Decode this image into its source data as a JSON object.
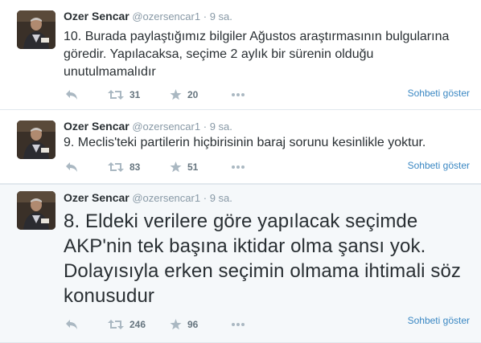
{
  "tweets": [
    {
      "name": "Ozer Sencar",
      "handle": "@ozersencar1",
      "dot": "·",
      "time": "9 sa.",
      "text": "10. Burada paylaştığımız bilgiler Ağustos araştırmasının bulgularına göredir. Yapılacaksa, seçime 2 aylık bir sürenin olduğu unutulmamalıdır",
      "retweets": "31",
      "favorites": "20",
      "conversation": "Sohbeti göster"
    },
    {
      "name": "Ozer Sencar",
      "handle": "@ozersencar1",
      "dot": "·",
      "time": "9 sa.",
      "text": "9. Meclis'teki partilerin hiçbirisinin baraj sorunu kesinlikle yoktur.",
      "retweets": "83",
      "favorites": "51",
      "conversation": "Sohbeti göster"
    },
    {
      "name": "Ozer Sencar",
      "handle": "@ozersencar1",
      "dot": "·",
      "time": "9 sa.",
      "text": "8. Eldeki verilere göre yapılacak seçimde AKP'nin tek başına iktidar olma şansı yok. Dolayısıyla erken seçimin olmama ihtimali söz konusudur",
      "retweets": "246",
      "favorites": "96",
      "conversation": "Sohbeti göster"
    }
  ],
  "icons": {
    "reply": "reply-arrow",
    "retweet": "retweet-arrows",
    "favorite": "star",
    "more": "ellipsis"
  },
  "colors": {
    "link": "#3b88c3",
    "muted": "#8899a6",
    "text": "#292f33",
    "divider": "#e1e8ed"
  }
}
